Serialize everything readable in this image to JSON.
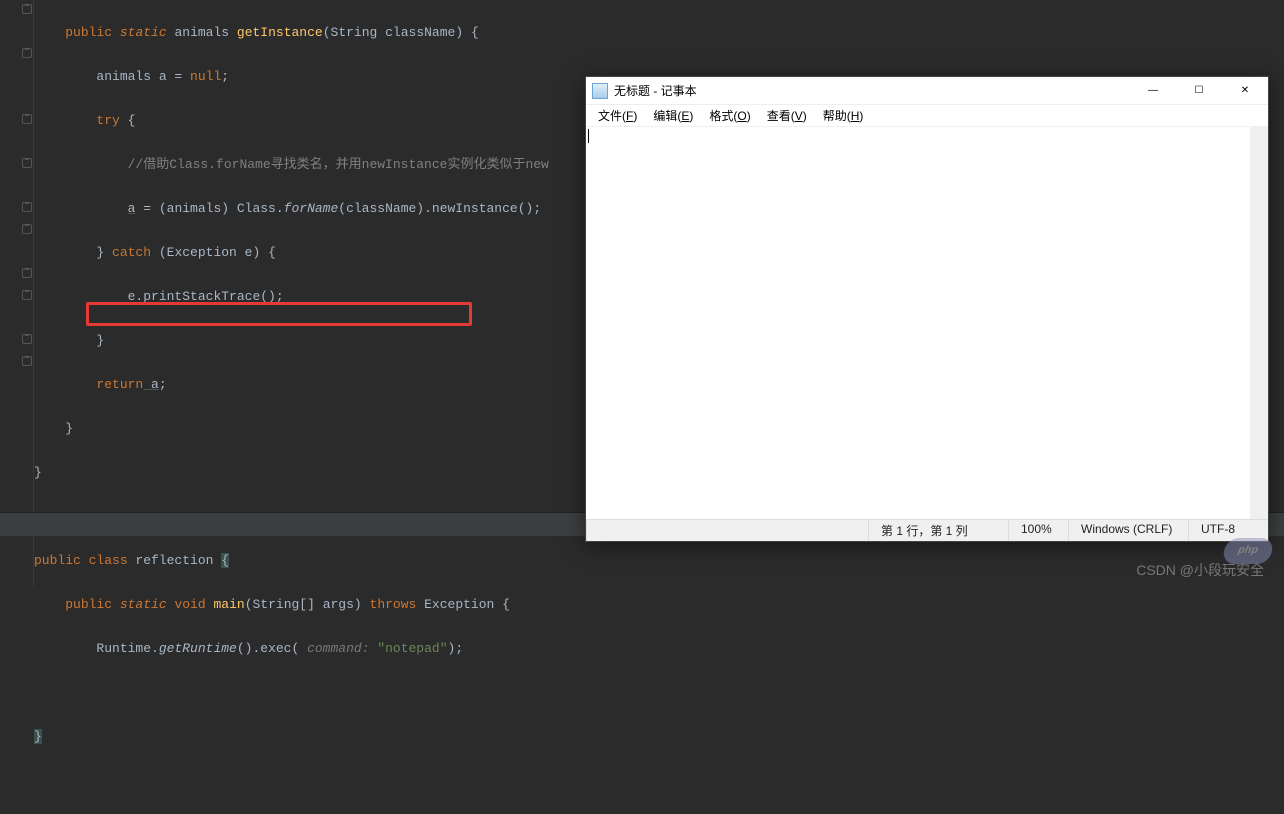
{
  "code": {
    "l1_kw_public": "public",
    "l1_kw_static": "static",
    "l1_type": "animals",
    "l1_method": "getInstance",
    "l1_params": "(String className) {",
    "l2_pre": "animals a = ",
    "l2_kw_null": "null",
    "l2_semi": ";",
    "l3_kw_try": "try",
    "l3_brace": " {",
    "l4_comment": "//借助Class.forName寻找类名，并用newInstance实例化类似于new",
    "l5_a": "a",
    "l5_eq": " = (animals) Class.",
    "l5_forName": "forName",
    "l5_paren1": "(className).newInstance();",
    "l6_brace": "} ",
    "l6_kw_catch": "catch",
    "l6_rest": " (Exception e) {",
    "l7": "e.printStackTrace();",
    "l8": "}",
    "l9_kw_return": "return",
    "l9_a": " a",
    "l9_semi": ";",
    "l10": "}",
    "l11": "}",
    "l13_kw_public": "public",
    "l13_kw_class": " class ",
    "l13_name": "reflection ",
    "l13_brace": "{",
    "l14_kw_public": "public",
    "l14_kw_static": " static ",
    "l14_kw_void": "void",
    "l14_main": " main",
    "l14_params": "(String[] args) ",
    "l14_kw_throws": "throws",
    "l14_exc": " Exception ",
    "l14_brace": "{",
    "l15_runtime": "Runtime.",
    "l15_getRuntime": "getRuntime",
    "l15_exec": "().exec(",
    "l15_hint": " command: ",
    "l15_str": "\"notepad\"",
    "l15_end": ");",
    "l17": "}"
  },
  "notepad": {
    "title": "无标题 - 记事本",
    "menu": {
      "file_pre": "文件(",
      "file_u": "F",
      "file_post": ")",
      "edit_pre": "编辑(",
      "edit_u": "E",
      "edit_post": ")",
      "format_pre": "格式(",
      "format_u": "O",
      "format_post": ")",
      "view_pre": "查看(",
      "view_u": "V",
      "view_post": ")",
      "help_pre": "帮助(",
      "help_u": "H",
      "help_post": ")"
    },
    "status": {
      "pos": "第 1 行，第 1 列",
      "zoom": "100%",
      "eol": "Windows (CRLF)",
      "encoding": "UTF-8"
    },
    "controls": {
      "min": "—",
      "max": "☐",
      "close": "✕"
    }
  },
  "watermark": {
    "csdn": "CSDN @小段玩安全",
    "php": "php"
  }
}
